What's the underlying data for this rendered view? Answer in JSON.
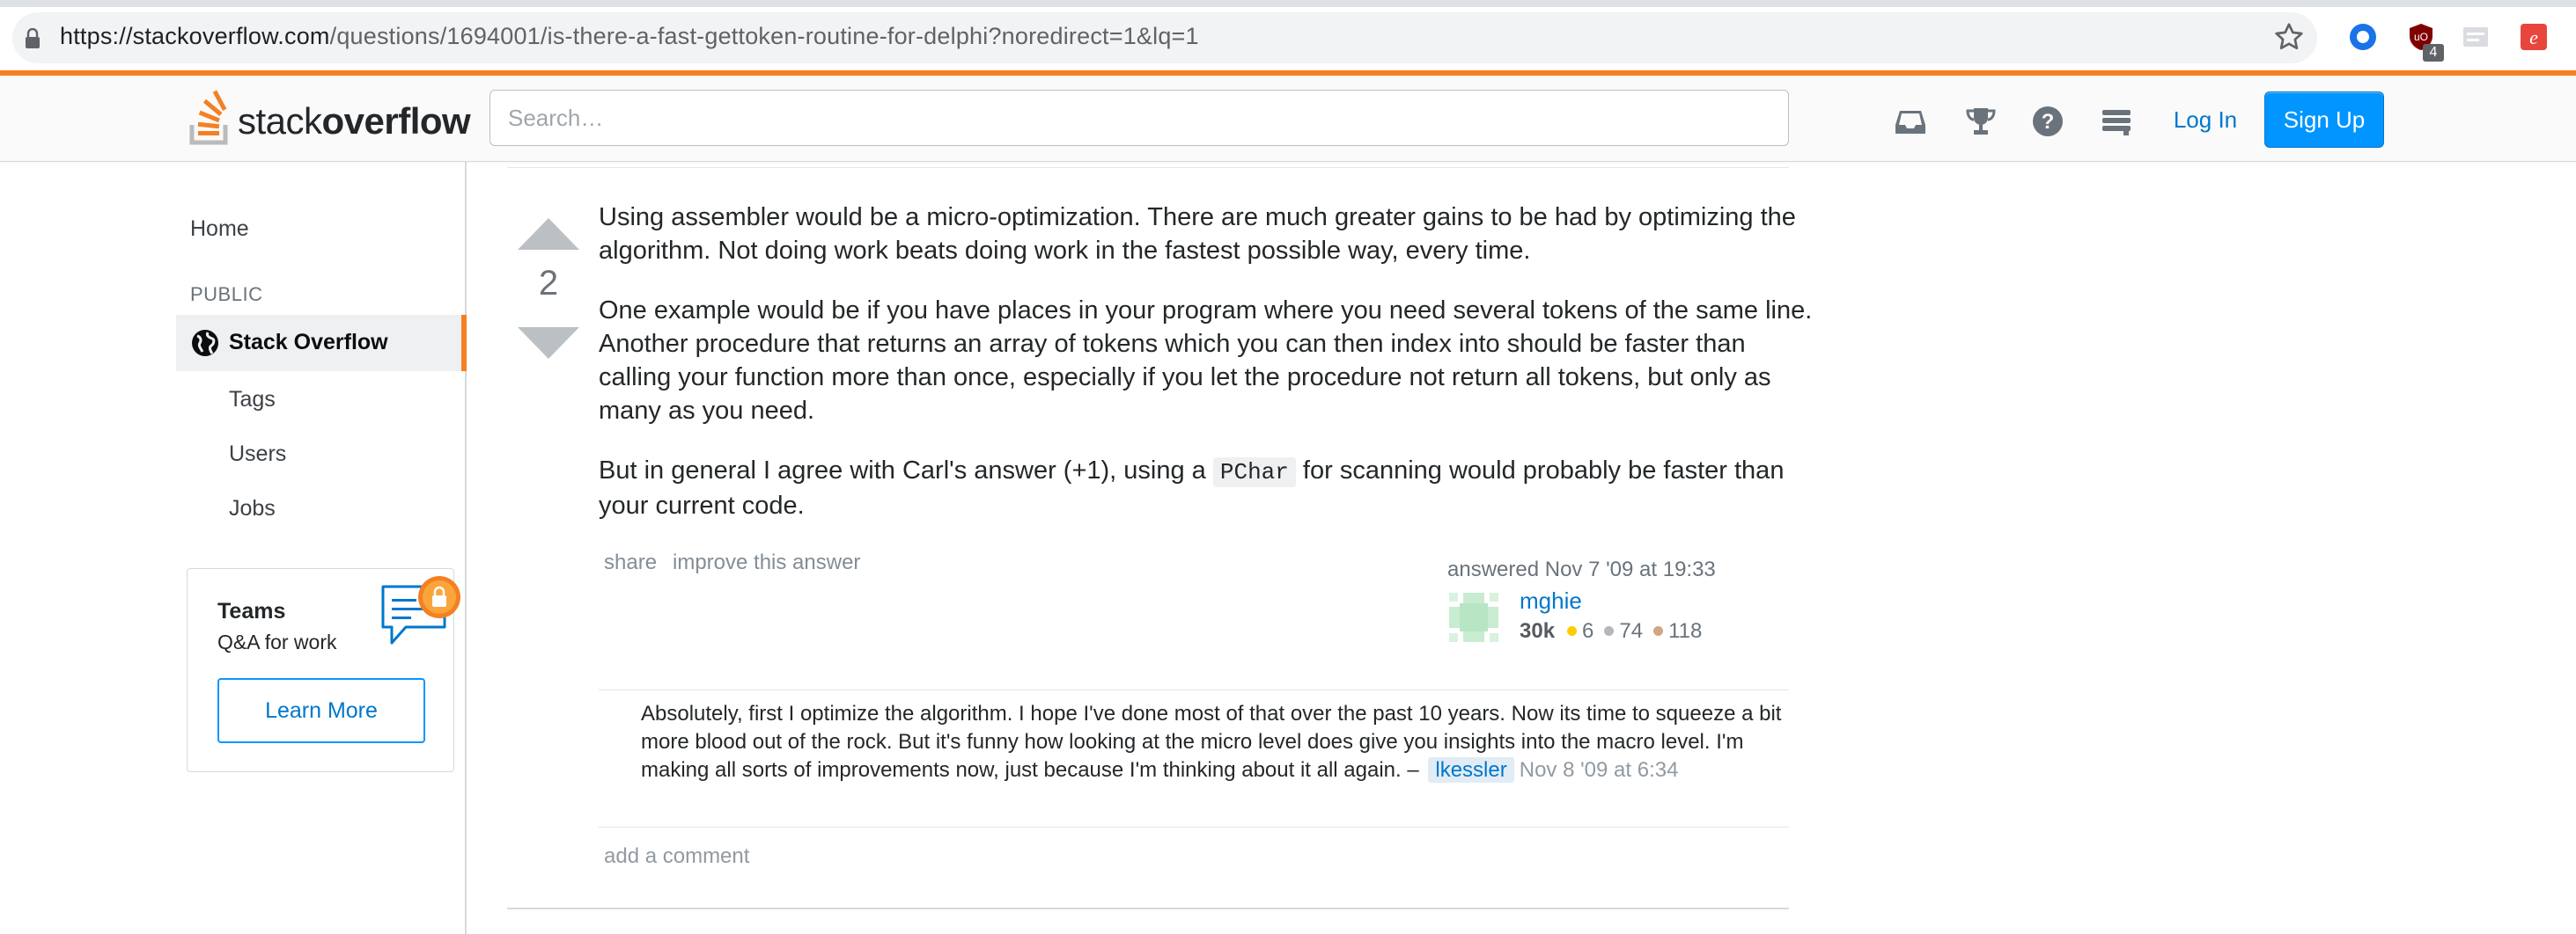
{
  "browser": {
    "url_host": "https://stackoverflow.com",
    "url_path": "/questions/1694001/is-there-a-fast-gettoken-routine-for-delphi?noredirect=1&lq=1",
    "extension_badge": "4"
  },
  "header": {
    "logo_light": "stack",
    "logo_bold": "overflow",
    "search_placeholder": "Search…",
    "login_label": "Log In",
    "signup_label": "Sign Up"
  },
  "sidebar": {
    "home": "Home",
    "public_heading": "PUBLIC",
    "stack_overflow": "Stack Overflow",
    "tags": "Tags",
    "users": "Users",
    "jobs": "Jobs",
    "teams_title": "Teams",
    "teams_subtitle": "Q&A for work",
    "learn_more": "Learn More"
  },
  "answer": {
    "vote_count": "2",
    "p1": "Using assembler would be a micro-optimization. There are much greater gains to be had by optimizing the algorithm. Not doing work beats doing work in the fastest possible way, every time.",
    "p2": "One example would be if you have places in your program where you need several tokens of the same line. Another procedure that returns an array of tokens which you can then index into should be faster than calling your function more than once, especially if you let the procedure not return all tokens, but only as many as you need.",
    "p3_before": "But in general I agree with Carl's answer (+1), using a ",
    "p3_code": "PChar",
    "p3_after": " for scanning would probably be faster than your current code.",
    "share": "share",
    "improve": "improve this answer",
    "answered": "answered Nov 7 '09 at 19:33",
    "user_name": "mghie",
    "user_rep": "30k",
    "gold": "6",
    "silver": "74",
    "bronze": "118"
  },
  "comment": {
    "text": "Absolutely, first I optimize the algorithm. I hope I've done most of that over the past 10 years. Now its time to squeeze a bit more blood out of the rock. But it's funny how looking at the micro level does give you insights into the macro level. I'm making all sorts of improvements now, just because I'm thinking about it all again. –",
    "user": "lkessler",
    "date": "Nov 8 '09 at 6:34",
    "add_comment": "add a comment"
  },
  "colors": {
    "accent_orange": "#f48024",
    "link_blue": "#0077cc",
    "signup_blue": "#0095ff",
    "gold": "#ffcc01",
    "silver": "#b4b8bc",
    "bronze": "#d1a684"
  },
  "icons": [
    "lock-icon",
    "star-icon",
    "inbox-icon",
    "trophy-icon",
    "help-icon",
    "review-queue-icon",
    "globe-icon",
    "upvote-icon",
    "downvote-icon"
  ]
}
